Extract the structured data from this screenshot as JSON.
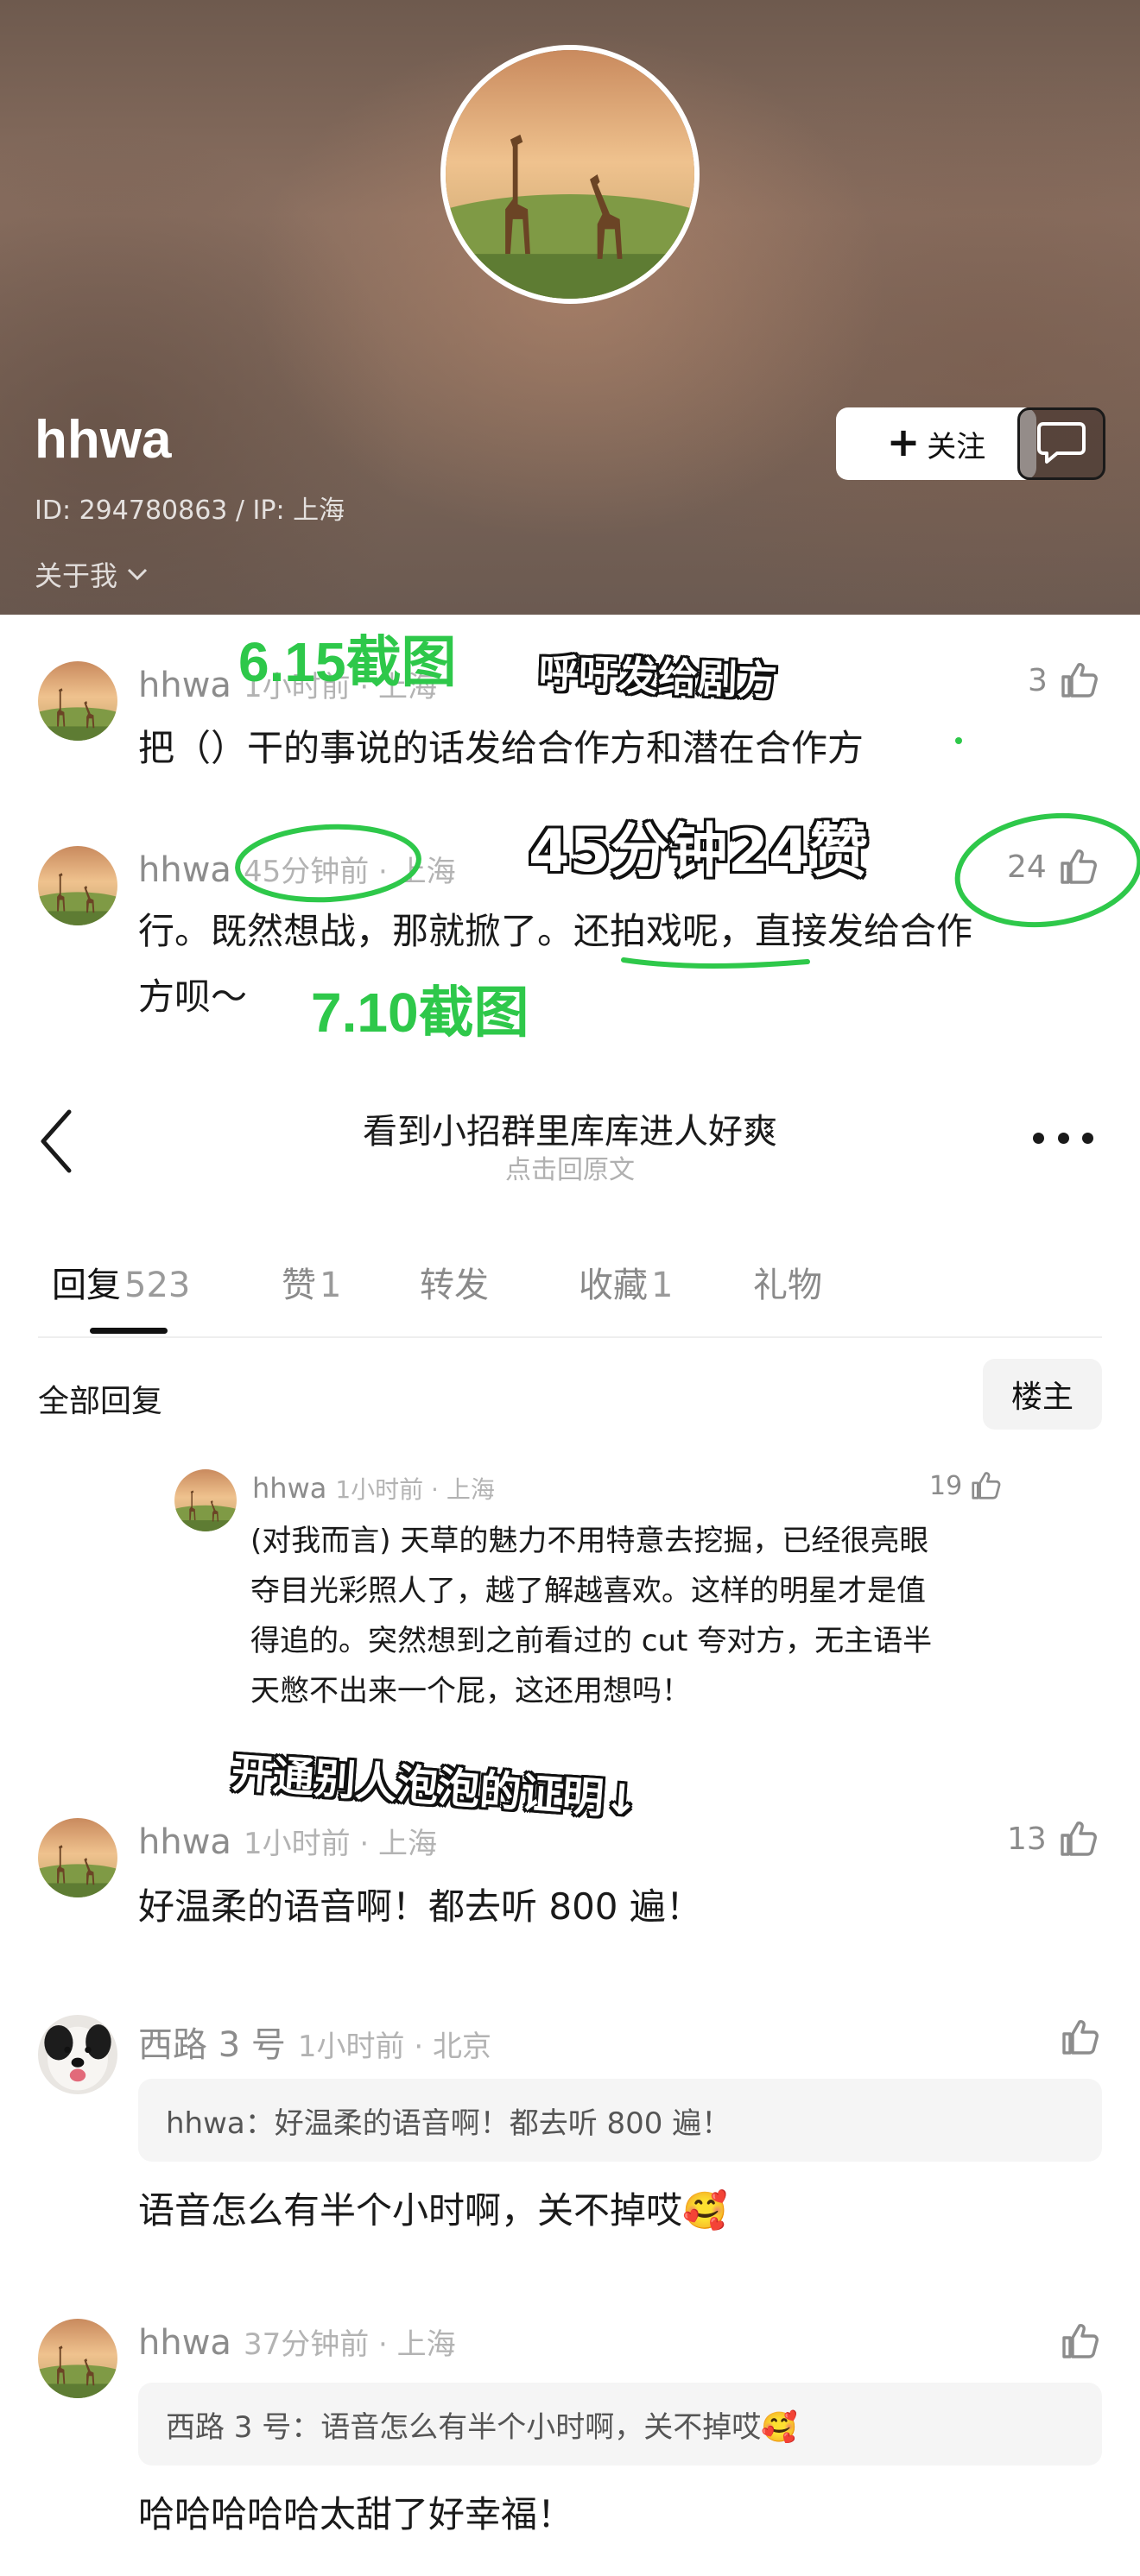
{
  "profile": {
    "name": "hhwa",
    "id_line": "ID: 294780863 / IP: 上海",
    "about": "关于我",
    "follow_label": "关注"
  },
  "annotations": {
    "screenshot_1": "6.15截图",
    "sticker_1": "呼吁发给剧方",
    "sticker_2": "45分钟24赞",
    "screenshot_2": "7.10截图",
    "sticker_3": "开通别人泡泡的证明↓"
  },
  "top_comments": [
    {
      "user": "hhwa",
      "meta": "1小时前 · 上海",
      "likes": "3",
      "text_lines": [
        "把（）干的事说的话发给合作方和潜在合作方"
      ]
    },
    {
      "user": "hhwa",
      "meta": "45分钟前 · 上海",
      "likes": "24",
      "text_lines": [
        "行。既然想战，那就掀了。还拍戏呢，直接发给合作",
        "方呗～"
      ]
    }
  ],
  "post": {
    "title": "看到小招群里库库进人好爽",
    "subtitle": "点击回原文"
  },
  "tabs": [
    {
      "label": "回复",
      "count": "523"
    },
    {
      "label": "赞",
      "count": "1"
    },
    {
      "label": "转发",
      "count": ""
    },
    {
      "label": "收藏",
      "count": "1"
    },
    {
      "label": "礼物",
      "count": ""
    }
  ],
  "replies_header": {
    "all_label": "全部回复",
    "host_label": "楼主"
  },
  "nested_comment": {
    "user": "hhwa",
    "meta": "1小时前 · 上海",
    "likes": "19",
    "text_lines": [
      "(对我而言) 天草的魅力不用特意去挖掘，已经很亮眼",
      "夺目光彩照人了，越了解越喜欢。这样的明星才是值",
      "得追的。突然想到之前看过的 cut 夸对方，无主语半",
      "天憋不出来一个屁，这还用想吗！"
    ]
  },
  "replies": [
    {
      "user": "hhwa",
      "meta": "1小时前 · 上海",
      "likes": "13",
      "text": "好温柔的语音啊！都去听 800 遍！"
    },
    {
      "user": "西路 3 号",
      "meta": "1小时前 · 北京",
      "likes": "",
      "quote": "hhwa：好温柔的语音啊！都去听 800 遍！",
      "text": "语音怎么有半个小时啊，关不掉哎🥰"
    },
    {
      "user": "hhwa",
      "meta": "37分钟前 · 上海",
      "likes": "",
      "quote": "西路 3 号：语音怎么有半个小时啊，关不掉哎🥰",
      "text": "哈哈哈哈哈太甜了好幸福！"
    }
  ]
}
